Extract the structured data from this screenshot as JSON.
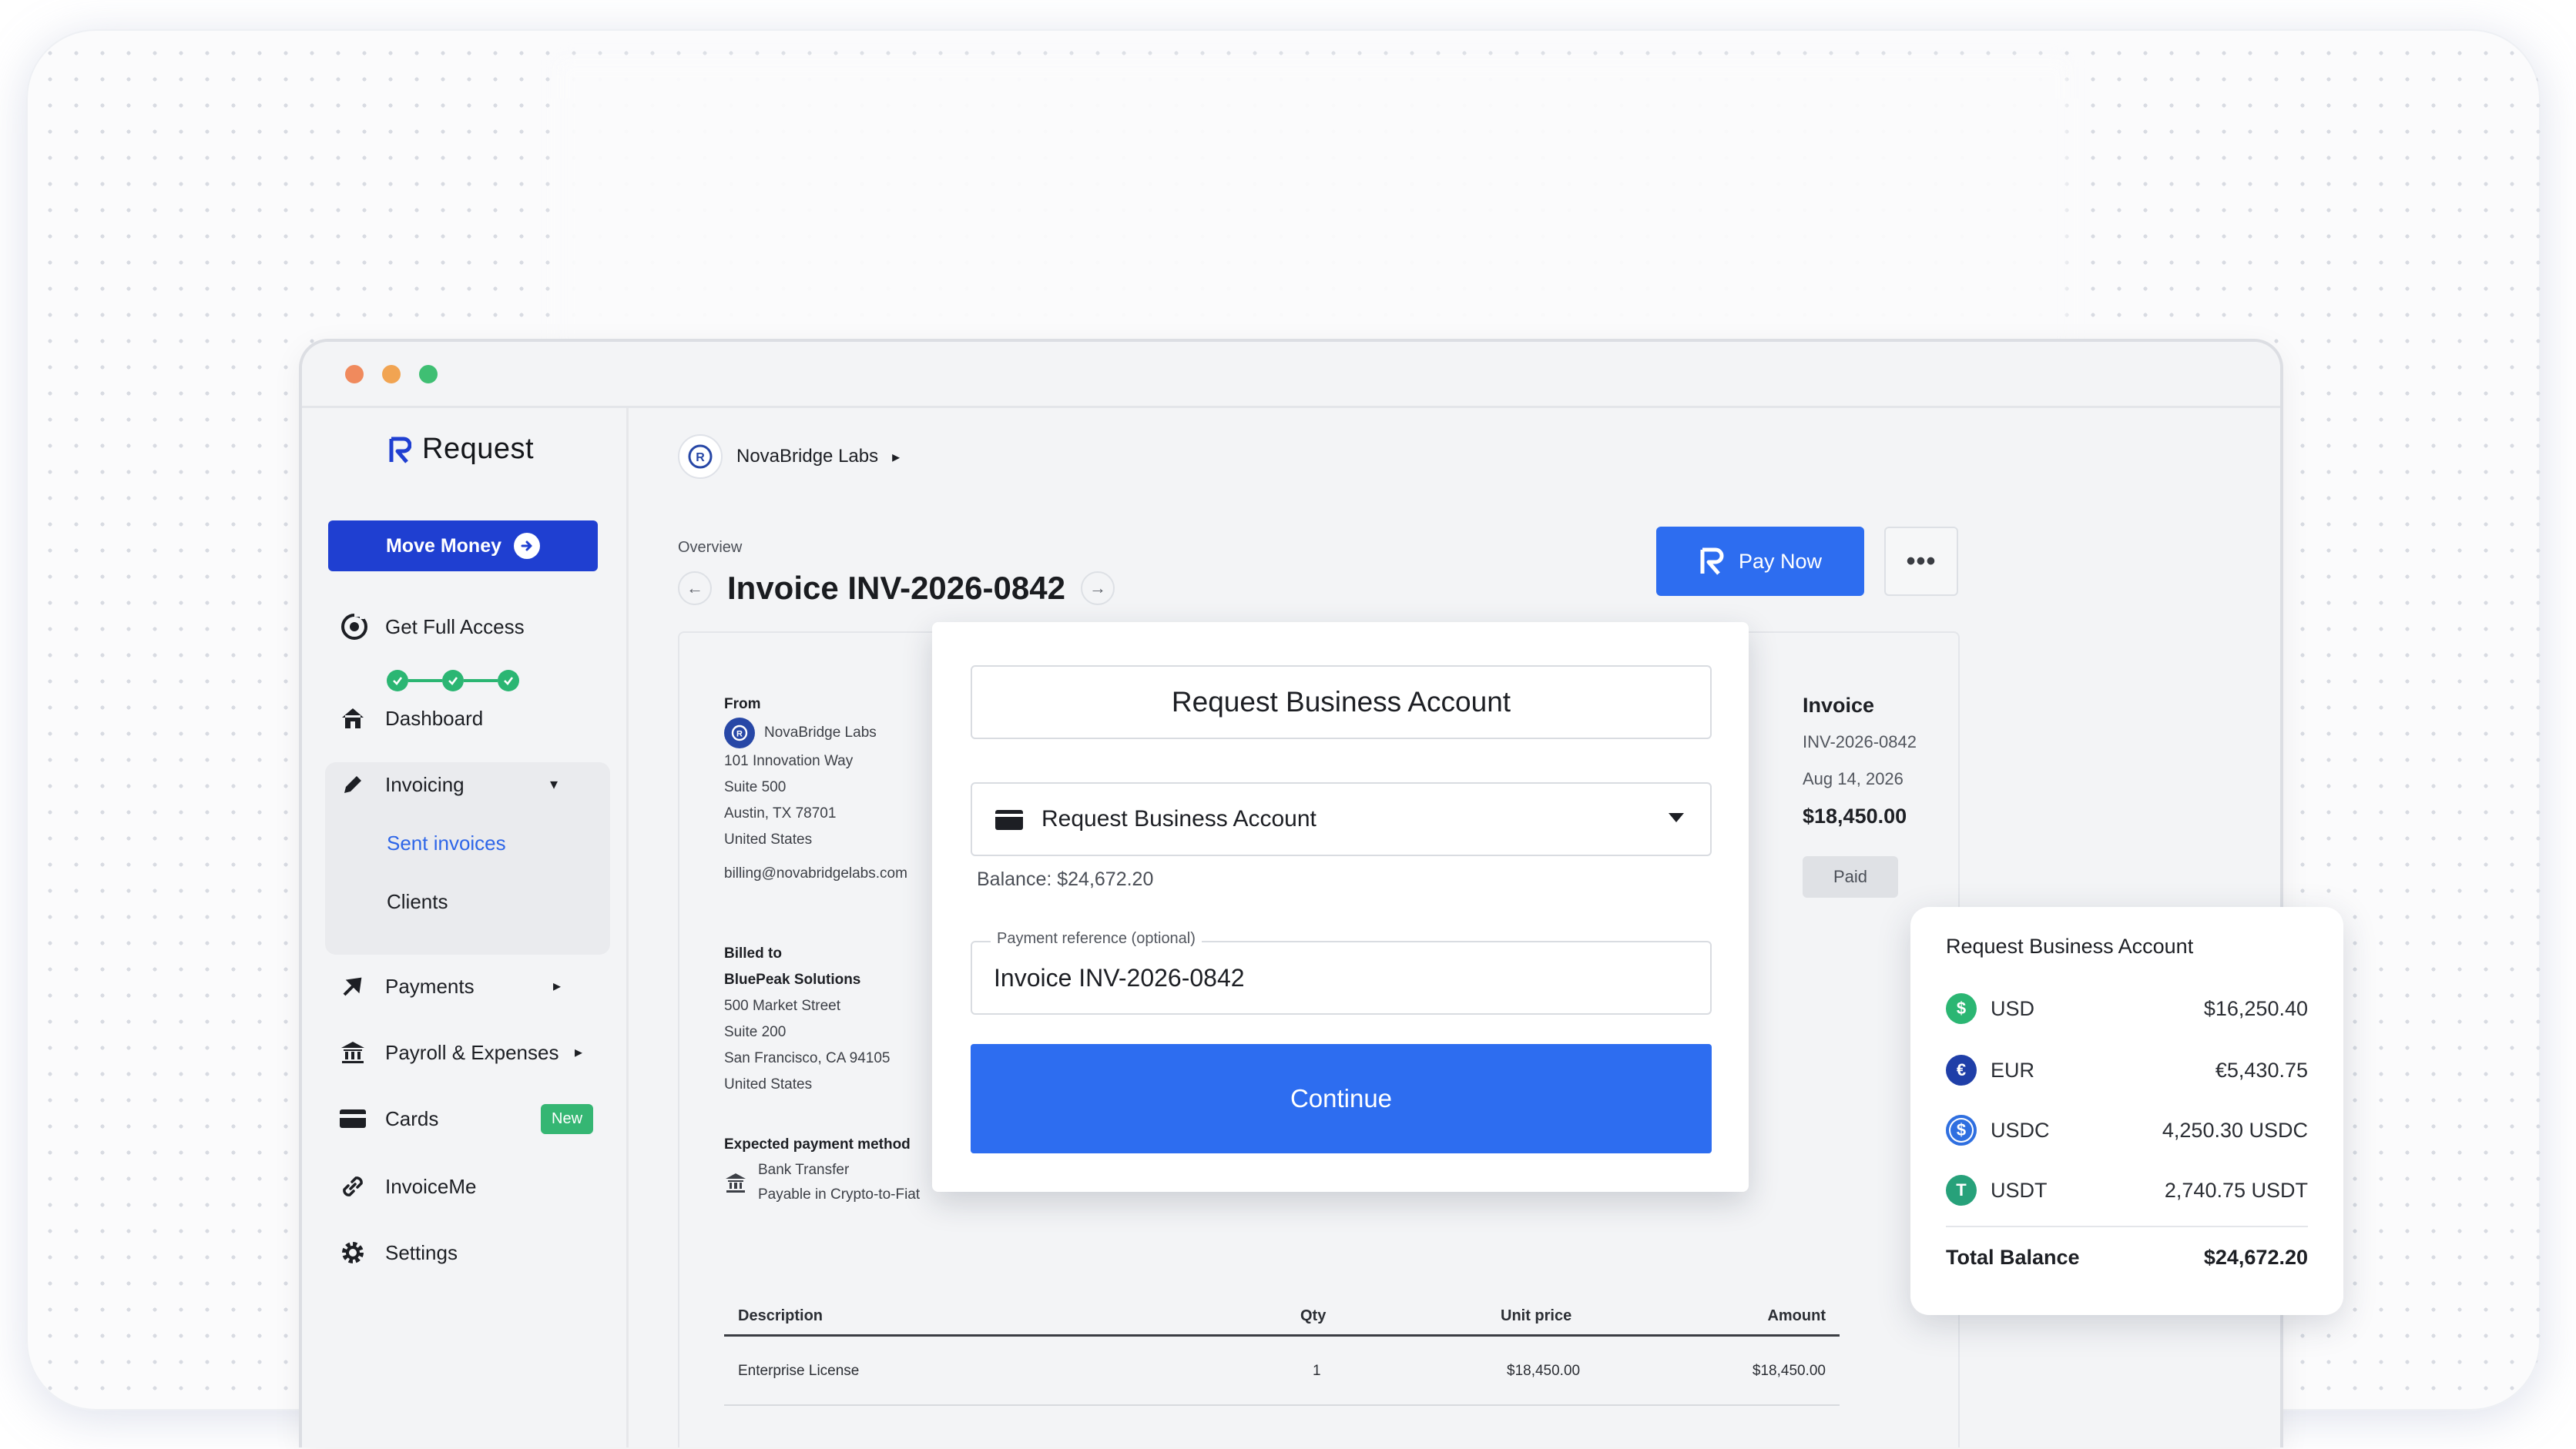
{
  "app": {
    "brand": "Request"
  },
  "sidebar": {
    "move_money": "Move Money",
    "get_full_access": "Get Full Access",
    "items": [
      {
        "label": "Dashboard"
      },
      {
        "label": "Invoicing"
      },
      {
        "label": "Payments"
      },
      {
        "label": "Payroll & Expenses"
      },
      {
        "label": "Cards"
      },
      {
        "label": "InvoiceMe"
      },
      {
        "label": "Settings"
      }
    ],
    "invoicing_sub": [
      {
        "label": "Sent invoices"
      },
      {
        "label": "Clients"
      }
    ],
    "cards_badge": "New"
  },
  "header": {
    "org_name": "NovaBridge Labs",
    "overview_label": "Overview",
    "title": "Invoice INV-2026-0842",
    "pay_now": "Pay Now",
    "more": "•••"
  },
  "invoice": {
    "from_heading": "From",
    "from_company": "NovaBridge Labs",
    "from_address": [
      "101 Innovation Way",
      "Suite 500",
      "Austin, TX 78701",
      "United States"
    ],
    "from_email": "billing@novabridgelabs.com",
    "billed_heading": "Billed to",
    "billed_company": "BluePeak Solutions",
    "billed_address": [
      "500 Market Street",
      "Suite 200",
      "San Francisco, CA 94105",
      "United States"
    ],
    "method_heading": "Expected payment method",
    "method_line1": "Bank Transfer",
    "method_line2": "Payable in Crypto-to-Fiat",
    "right_label": "Invoice",
    "right_number": "INV-2026-0842",
    "right_date": "Aug 14, 2026",
    "right_amount": "$18,450.00",
    "status": "Paid",
    "table": {
      "headers": {
        "description": "Description",
        "qty": "Qty",
        "unit_price": "Unit price",
        "amount": "Amount"
      },
      "rows": [
        {
          "description": "Enterprise License",
          "qty": "1",
          "unit_price": "$18,450.00",
          "amount": "$18,450.00"
        }
      ]
    }
  },
  "modal": {
    "title": "Request Business Account",
    "select_value": "Request Business Account",
    "balance": "Balance: $24,672.20",
    "ref_label": "Payment reference (optional)",
    "ref_value": "Invoice INV-2026-0842",
    "continue": "Continue"
  },
  "balance_card": {
    "title": "Request Business Account",
    "rows": [
      {
        "currency": "USD",
        "symbol": "$",
        "value": "$16,250.40",
        "color": "#2bb673"
      },
      {
        "currency": "EUR",
        "symbol": "€",
        "value": "€5,430.75",
        "color": "#1f3fa8"
      },
      {
        "currency": "USDC",
        "symbol": "$",
        "value": "4,250.30 USDC",
        "color": "#2f6fe0"
      },
      {
        "currency": "USDT",
        "symbol": "T",
        "value": "2,740.75 USDT",
        "color": "#27a17a"
      }
    ],
    "total_label": "Total Balance",
    "total_value": "$24,672.20"
  },
  "colors": {
    "primary": "#2d6df0",
    "sidebar_button": "#1f3fd1",
    "success": "#2bb673",
    "link": "#2e66e8"
  }
}
